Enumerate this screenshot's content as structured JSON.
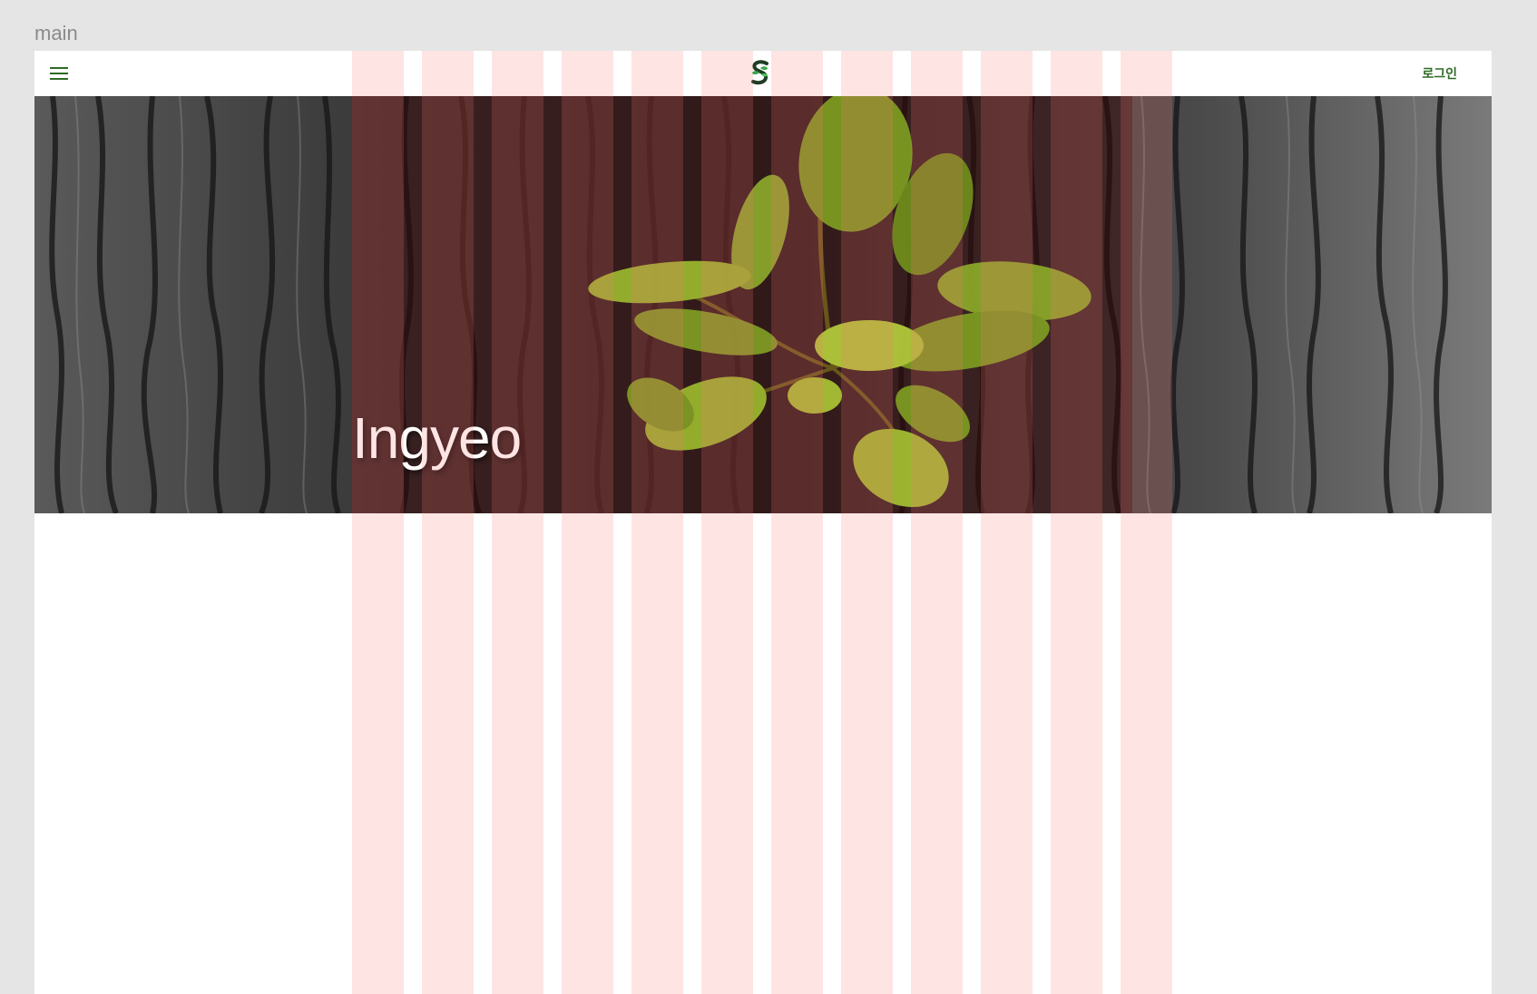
{
  "artboard": {
    "label": "main"
  },
  "appbar": {
    "menu_icon": "hamburger-menu-icon",
    "logo_icon": "leaf-s-logo-icon",
    "login_label": "로그인"
  },
  "hero": {
    "title": "Ingyeo",
    "image": "tree-bark-with-green-leaves"
  },
  "grid": {
    "columns": 12,
    "column_color": "#ffe1e1"
  },
  "colors": {
    "accent": "#2e6b25",
    "background": "#e5e5e5",
    "surface": "#ffffff"
  }
}
